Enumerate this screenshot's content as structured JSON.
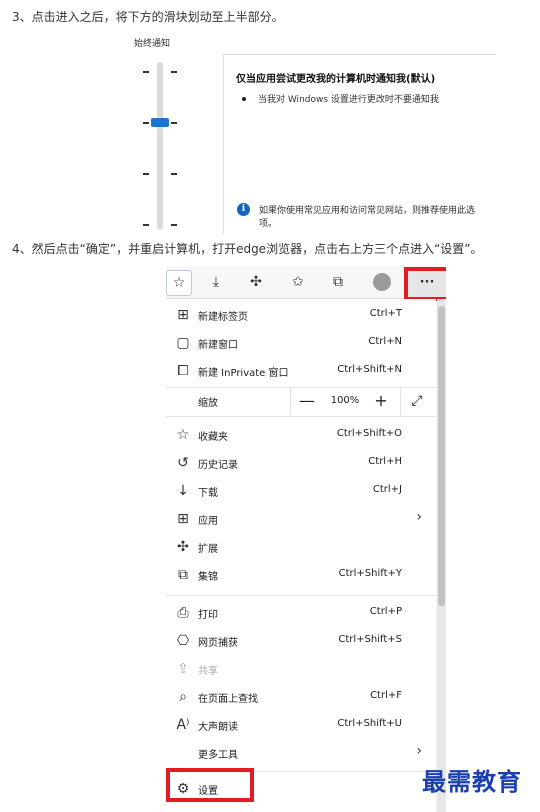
{
  "steps": {
    "step3": "3、点击进入之后，将下方的滑块划动至上半部分。",
    "step4": "4、然后点击“确定”，并重启计算机，打开edge浏览器，点击右上方三个点进入“设置”。"
  },
  "uac": {
    "slider_title": "始终通知",
    "heading": "仅当应用尝试更改我的计算机时通知我(默认)",
    "bullet": "当我对 Windows 设置进行更改时不要通知我",
    "info": "如果你使用常见应用和访问常见网站，则推荐使用此选项。",
    "accent": "#1976d2"
  },
  "toolbar": {
    "fav_add_icon": "add-favorite-icon",
    "download_icon": "download-icon",
    "extensions_icon": "extensions-icon",
    "favorites_icon": "favorites-icon",
    "collections_icon": "collections-icon",
    "profile_icon": "profile-avatar-icon",
    "more_label": "···"
  },
  "menu": {
    "new_tab": {
      "label": "新建标签页",
      "shortcut": "Ctrl+T"
    },
    "new_window": {
      "label": "新建窗口",
      "shortcut": "Ctrl+N"
    },
    "new_inprivate": {
      "label": "新建 InPrivate 窗口",
      "shortcut": "Ctrl+Shift+N"
    },
    "zoom": {
      "label": "缩放",
      "minus": "—",
      "value": "100%",
      "plus": "+",
      "full": "⤢"
    },
    "favorites": {
      "label": "收藏夹",
      "shortcut": "Ctrl+Shift+O"
    },
    "history": {
      "label": "历史记录",
      "shortcut": "Ctrl+H"
    },
    "downloads": {
      "label": "下载",
      "shortcut": "Ctrl+J"
    },
    "apps": {
      "label": "应用"
    },
    "extensions": {
      "label": "扩展"
    },
    "collections": {
      "label": "集锦",
      "shortcut": "Ctrl+Shift+Y"
    },
    "print": {
      "label": "打印",
      "shortcut": "Ctrl+P"
    },
    "web_capture": {
      "label": "网页捕获",
      "shortcut": "Ctrl+Shift+S"
    },
    "share": {
      "label": "共享"
    },
    "find": {
      "label": "在页面上查找",
      "shortcut": "Ctrl+F"
    },
    "read_aloud": {
      "label": "大声朗读",
      "shortcut": "Ctrl+Shift+U"
    },
    "more_tools": {
      "label": "更多工具"
    },
    "settings": {
      "label": "设置"
    }
  },
  "highlight_color": "#e31b23",
  "watermark": "最需教育"
}
